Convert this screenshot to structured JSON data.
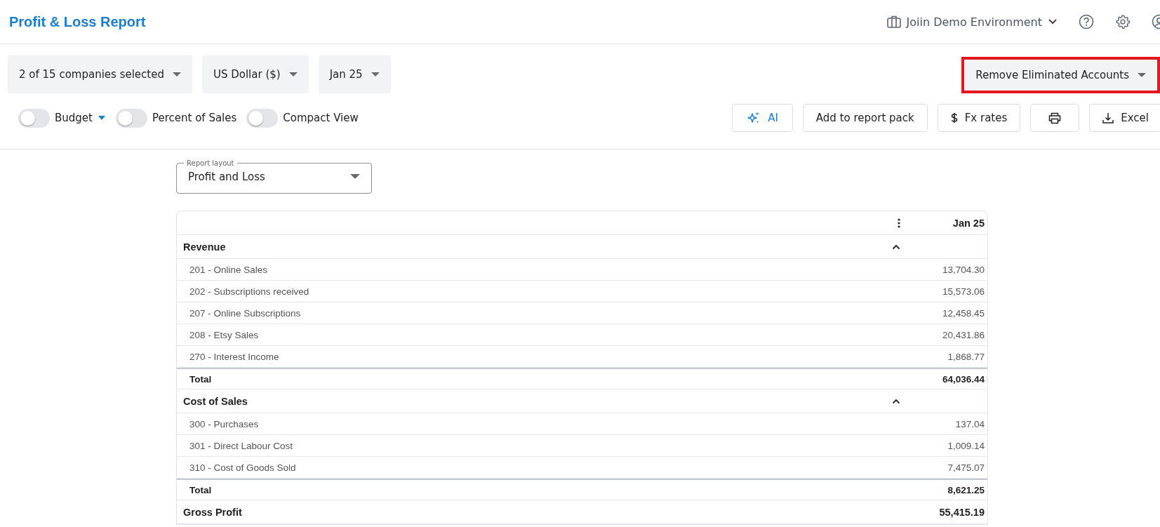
{
  "header": {
    "title": "Profit & Loss Report",
    "environment": "Joiin Demo Environment"
  },
  "filters": [
    {
      "label": "2 of 15 companies selected"
    },
    {
      "label": "US Dollar ($)"
    },
    {
      "label": "Jan 25"
    }
  ],
  "elimination": {
    "label": "Remove Eliminated Accounts",
    "highlighted": true
  },
  "toggles": [
    {
      "label": "Budget",
      "on": false,
      "has_menu": true
    },
    {
      "label": "Percent of Sales",
      "on": false,
      "has_menu": false
    },
    {
      "label": "Compact View",
      "on": false,
      "has_menu": false
    }
  ],
  "actions": [
    {
      "kind": "ai",
      "label": "AI"
    },
    {
      "kind": "plain",
      "label": "Add to report pack"
    },
    {
      "kind": "dollar",
      "label": "Fx rates"
    },
    {
      "kind": "print"
    },
    {
      "kind": "download",
      "label": "Excel"
    }
  ],
  "report_layout": {
    "label": "Report layout",
    "value": "Profit and Loss"
  },
  "table": {
    "column": "Jan 25",
    "sections": [
      {
        "title": "Revenue",
        "expanded": true,
        "rows": [
          {
            "account": "201 - Online Sales",
            "amount": "13,704.30"
          },
          {
            "account": "202 - Subscriptions received",
            "amount": "15,573.06"
          },
          {
            "account": "207 - Online Subscriptions",
            "amount": "12,458.45"
          },
          {
            "account": "208 - Etsy Sales",
            "amount": "20,431.86"
          },
          {
            "account": "270 - Interest Income",
            "amount": "1,868.77"
          }
        ],
        "total_label": "Total",
        "total": "64,036.44"
      },
      {
        "title": "Cost of Sales",
        "expanded": true,
        "rows": [
          {
            "account": "300 - Purchases",
            "amount": "137.04"
          },
          {
            "account": "301 - Direct Labour Cost",
            "amount": "1,009.14"
          },
          {
            "account": "310 - Cost of Goods Sold",
            "amount": "7,475.07"
          }
        ],
        "total_label": "Total",
        "total": "8,621.25"
      }
    ],
    "summary": {
      "label": "Gross Profit",
      "amount": "55,415.19"
    }
  }
}
